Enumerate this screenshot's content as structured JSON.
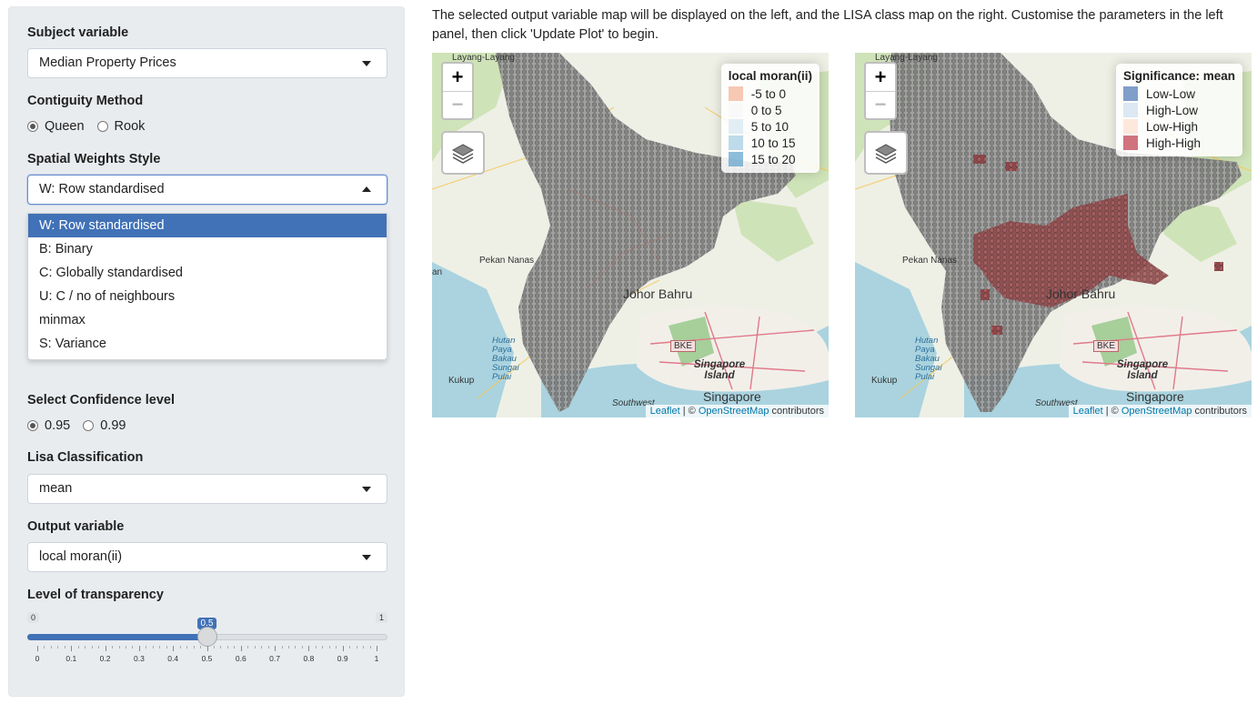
{
  "sidebar": {
    "subject_label": "Subject variable",
    "subject_value": "Median Property Prices",
    "contiguity_label": "Contiguity Method",
    "contiguity_options": [
      "Queen",
      "Rook"
    ],
    "contiguity_selected": "Queen",
    "weights_label": "Spatial Weights Style",
    "weights_value": "W: Row standardised",
    "weights_options": [
      "W: Row standardised",
      "B: Binary",
      "C: Globally standardised",
      "U: C / no of neighbours",
      "minmax",
      "S: Variance"
    ],
    "confidence_label": "Select Confidence level",
    "confidence_options": [
      "0.95",
      "0.99"
    ],
    "confidence_selected": "0.95",
    "lisa_label": "Lisa Classification",
    "lisa_value": "mean",
    "output_label": "Output variable",
    "output_value": "local moran(ii)",
    "transparency_label": "Level of transparency",
    "slider": {
      "min": 0,
      "max": 1,
      "value": 0.5,
      "min_label": "0",
      "max_label": "1",
      "value_label": "0.5",
      "tick_labels": [
        "0",
        "0.1",
        "0.2",
        "0.3",
        "0.4",
        "0.5",
        "0.6",
        "0.7",
        "0.8",
        "0.9",
        "1"
      ]
    }
  },
  "main": {
    "intro_text": "The selected output variable map will be displayed on the left, and the LISA class map on the right. Customise the parameters in the left panel, then click 'Update Plot' to begin.",
    "map_controls": {
      "zoom_in": "+",
      "zoom_out": "−"
    },
    "place_labels": {
      "layang": "Layang-Layang",
      "pekan": "Pekan Nanas",
      "johor": "Johor Bahru",
      "hutan": "Hutan Paya Bakau Sungai Pulai",
      "kukup": "Kukup",
      "bke": "BKE",
      "sg_island": "Singapore Island",
      "singapore": "Singapore",
      "southwest": "Southwest",
      "an": "an"
    },
    "attribution": {
      "leaflet": "Leaflet",
      "sep": " | © ",
      "osm": "OpenStreetMap",
      "rest": " contributors"
    },
    "left_legend": {
      "title": "local moran(ii)",
      "items": [
        {
          "label": "-5 to 0",
          "color": "#f4a582"
        },
        {
          "label": "0 to 5",
          "color": "#f7f7f7"
        },
        {
          "label": "5 to 10",
          "color": "#d1e5f0"
        },
        {
          "label": "10 to 15",
          "color": "#92c5de"
        },
        {
          "label": "15 to 20",
          "color": "#4393c3"
        }
      ]
    },
    "right_legend": {
      "title": "Significance: mean",
      "items": [
        {
          "label": "Low-Low",
          "color": "#2c5fa8"
        },
        {
          "label": "High-Low",
          "color": "#c6dbef"
        },
        {
          "label": "Low-High",
          "color": "#fddbc7"
        },
        {
          "label": "High-High",
          "color": "#b2182b"
        }
      ]
    }
  }
}
